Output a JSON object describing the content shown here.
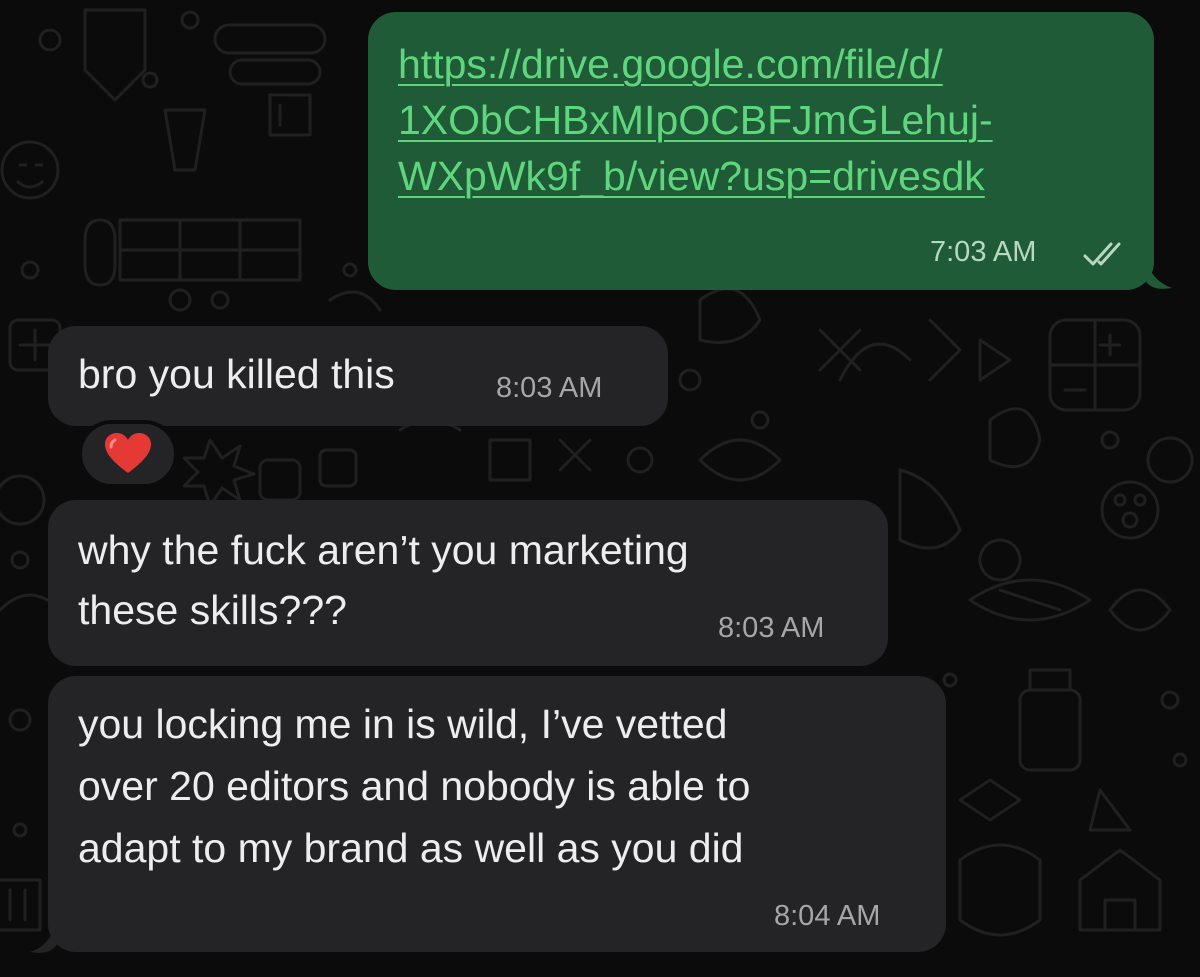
{
  "chat": {
    "sent_link": {
      "lines": [
        "https://drive.google.com/file/d/",
        "1XObCHBxMIpOCBFJmGLehuj-",
        "WXpWk9f_b/view?usp=drivesdk"
      ],
      "time": "7:03 AM",
      "status_icon": "double-check-icon"
    },
    "received": [
      {
        "lines": [
          "bro you killed this"
        ],
        "time": "8:03 AM",
        "reaction": "heart-icon"
      },
      {
        "lines": [
          "why the fuck aren’t you marketing",
          "these skills???"
        ],
        "time": "8:03 AM"
      },
      {
        "lines": [
          "you locking me in is wild, I’ve vetted",
          "over 20 editors and nobody is able to",
          "adapt to my brand as well as you did"
        ],
        "time": "8:04 AM"
      }
    ]
  },
  "colors": {
    "background": "#0b0b0b",
    "outgoing_bubble": "#1e5b36",
    "incoming_bubble": "#242426",
    "link": "#5fd67d",
    "heart": "#e53935"
  }
}
